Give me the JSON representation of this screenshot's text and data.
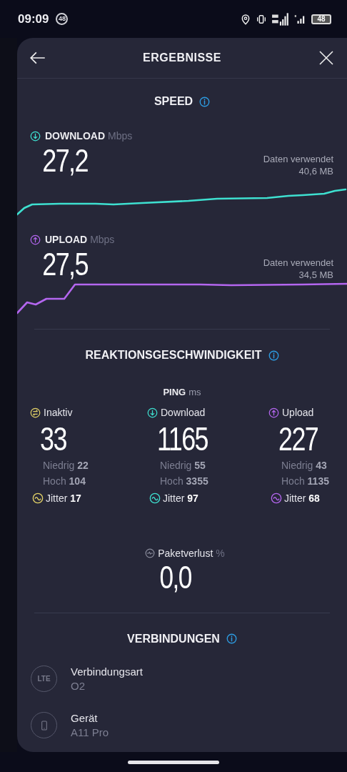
{
  "status_bar": {
    "time": "09:09",
    "notification_count": "48",
    "battery": "48"
  },
  "header": {
    "title": "ERGEBNISSE"
  },
  "speed": {
    "title": "SPEED",
    "tests": [
      {
        "kind": "download",
        "label": "DOWNLOAD",
        "unit": "Mbps",
        "value": "27,2",
        "data_label": "Daten verwendet",
        "data_value": "40,6 MB"
      },
      {
        "kind": "upload",
        "label": "UPLOAD",
        "unit": "Mbps",
        "value": "27,5",
        "data_label": "Daten verwendet",
        "data_value": "34,5 MB"
      }
    ]
  },
  "responsiveness": {
    "title": "REAKTIONSGESCHWINDIGKEIT",
    "ping_label": "PING",
    "ping_unit": "ms",
    "columns": [
      {
        "kind": "idle",
        "label": "Inaktiv",
        "value": "33",
        "low_label": "Niedrig",
        "low": "22",
        "high_label": "Hoch",
        "high": "104",
        "jitter_label": "Jitter",
        "jitter": "17"
      },
      {
        "kind": "download",
        "label": "Download",
        "value": "1165",
        "low_label": "Niedrig",
        "low": "55",
        "high_label": "Hoch",
        "high": "3355",
        "jitter_label": "Jitter",
        "jitter": "97"
      },
      {
        "kind": "upload",
        "label": "Upload",
        "value": "227",
        "low_label": "Niedrig",
        "low": "43",
        "high_label": "Hoch",
        "high": "1135",
        "jitter_label": "Jitter",
        "jitter": "68"
      }
    ],
    "packet_loss": {
      "label": "Paketverlust",
      "unit": "%",
      "value": "0,0"
    }
  },
  "connections": {
    "title": "VERBINDUNGEN",
    "items": [
      {
        "kind": "lte",
        "badge": "LTE",
        "label": "Verbindungsart",
        "value": "O2"
      },
      {
        "kind": "device",
        "label": "Gerät",
        "value": "A11 Pro"
      }
    ]
  }
}
